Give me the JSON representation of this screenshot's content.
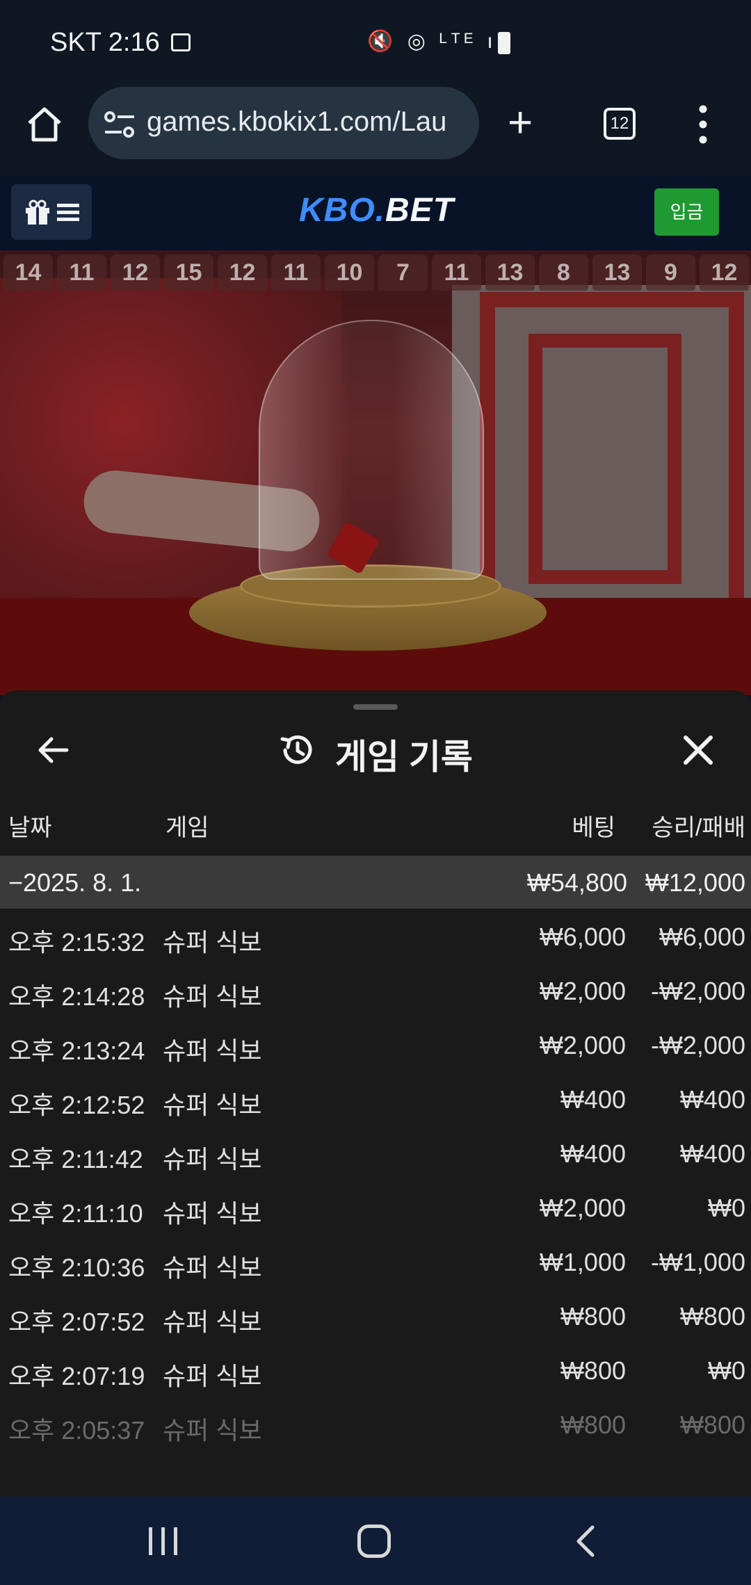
{
  "status_bar": {
    "carrier_time": "SKT 2:16",
    "icons": "🔇 ◎ ᴸᵀᴱ ıll"
  },
  "browser": {
    "url": "games.kbokix1.com/Lau",
    "tab_count": "12"
  },
  "site": {
    "logo_part1": "KBO.",
    "logo_part2": "BET",
    "deposit_label": "입금"
  },
  "scoreboard": [
    "14",
    "11",
    "12",
    "15",
    "12",
    "11",
    "10",
    "7",
    "11",
    "13",
    "8",
    "13",
    "9",
    "12"
  ],
  "history": {
    "title": "게임 기록",
    "columns": {
      "date": "날짜",
      "game": "게임",
      "bet": "베팅",
      "win_loss": "승리/패배"
    },
    "date_group": {
      "date": "−2025. 8. 1.",
      "bet_total": "₩54,800",
      "win_loss_total": "₩12,000"
    },
    "rows": [
      {
        "time": "오후 2:15:32",
        "game": "슈퍼 식보",
        "bet": "₩6,000",
        "result": "₩6,000"
      },
      {
        "time": "오후 2:14:28",
        "game": "슈퍼 식보",
        "bet": "₩2,000",
        "result": "-₩2,000"
      },
      {
        "time": "오후 2:13:24",
        "game": "슈퍼 식보",
        "bet": "₩2,000",
        "result": "-₩2,000"
      },
      {
        "time": "오후 2:12:52",
        "game": "슈퍼 식보",
        "bet": "₩400",
        "result": "₩400"
      },
      {
        "time": "오후 2:11:42",
        "game": "슈퍼 식보",
        "bet": "₩400",
        "result": "₩400"
      },
      {
        "time": "오후 2:11:10",
        "game": "슈퍼 식보",
        "bet": "₩2,000",
        "result": "₩0"
      },
      {
        "time": "오후 2:10:36",
        "game": "슈퍼 식보",
        "bet": "₩1,000",
        "result": "-₩1,000"
      },
      {
        "time": "오후 2:07:52",
        "game": "슈퍼 식보",
        "bet": "₩800",
        "result": "₩800"
      },
      {
        "time": "오후 2:07:19",
        "game": "슈퍼 식보",
        "bet": "₩800",
        "result": "₩0"
      },
      {
        "time": "오후 2:05:37",
        "game": "슈퍼 식보",
        "bet": "₩800",
        "result": "₩800"
      }
    ]
  },
  "colors": {
    "accent_blue": "#3f8dff",
    "deposit_green": "#1f9a31",
    "sheet_bg": "#1a1a1a"
  }
}
